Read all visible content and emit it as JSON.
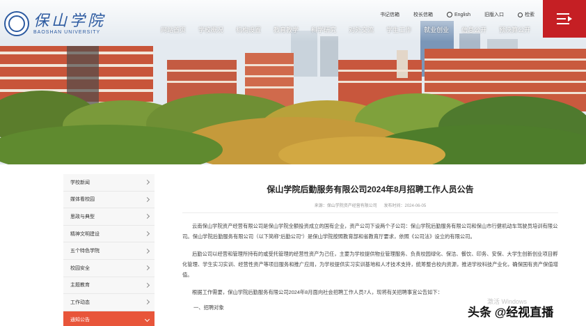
{
  "header": {
    "logo": {
      "cn": "保山学院",
      "en": "BAOSHAN UNIVERSITY"
    },
    "toplinks": [
      "书记信箱",
      "校长信箱",
      "English",
      "旧版入口",
      "检索"
    ],
    "nav": [
      "网站首页",
      "学校概况",
      "机构设置",
      "教育教学",
      "科学研究",
      "对外交流",
      "学生工作",
      "就业创业",
      "信息公开",
      "预决算公开"
    ],
    "colors": {
      "brand_blue": "#2c5aa0",
      "menu_red": "#c51f24",
      "active_orange": "#e8553a"
    }
  },
  "sidebar": {
    "items": [
      {
        "label": "学校新闻"
      },
      {
        "label": "媒体看校园"
      },
      {
        "label": "思政与典型"
      },
      {
        "label": "精神文明建设"
      },
      {
        "label": "五个特色学院"
      },
      {
        "label": "校园安全"
      },
      {
        "label": "主题教育"
      },
      {
        "label": "工作动态"
      },
      {
        "label": "通知公告",
        "active": true
      }
    ]
  },
  "article": {
    "title": "保山学院后勤服务有限公司2024年8月招聘工作人员公告",
    "source": "来源：保山学院资产经营有限公司",
    "date": "发布时间：2024-06-05",
    "paragraphs": [
      "云南保山学院资产经营有限公司是保山学院全额投资成立的国有企业，资产公司下设两个子公司：保山学院后勤服务有限公司和保山市行健机动车驾驶员培训有限公司。保山学院后勤服务有限公司（以下简称“后勤公司”）是保山学院按照教育部和省教育厅要求，依照《公司法》设立的有限公司。",
      "后勤公司以经营和管理所持有的或受托管理的经营性资产为己任，主要为学校提供物业管理服务、负责校园绿化、保洁、餐饮、印务、安保、大学生创新创业项目孵化管理、学生实习实训、经营性资产等项目服务和推广应用，为学校提供实习实训基地和人才技术支持，统筹整合校内资源，推进学校科技产业化，确保国有资产保值增值。",
      "根据工作需要，保山学院后勤服务有限公司2024年8月面向社会招聘工作人员7人，现将有关招聘事宜公告如下："
    ],
    "section": "一、招聘对象"
  },
  "overlay": {
    "windows_watermark": "激活 Windows",
    "platform_watermark": "头条 @经视直播"
  }
}
